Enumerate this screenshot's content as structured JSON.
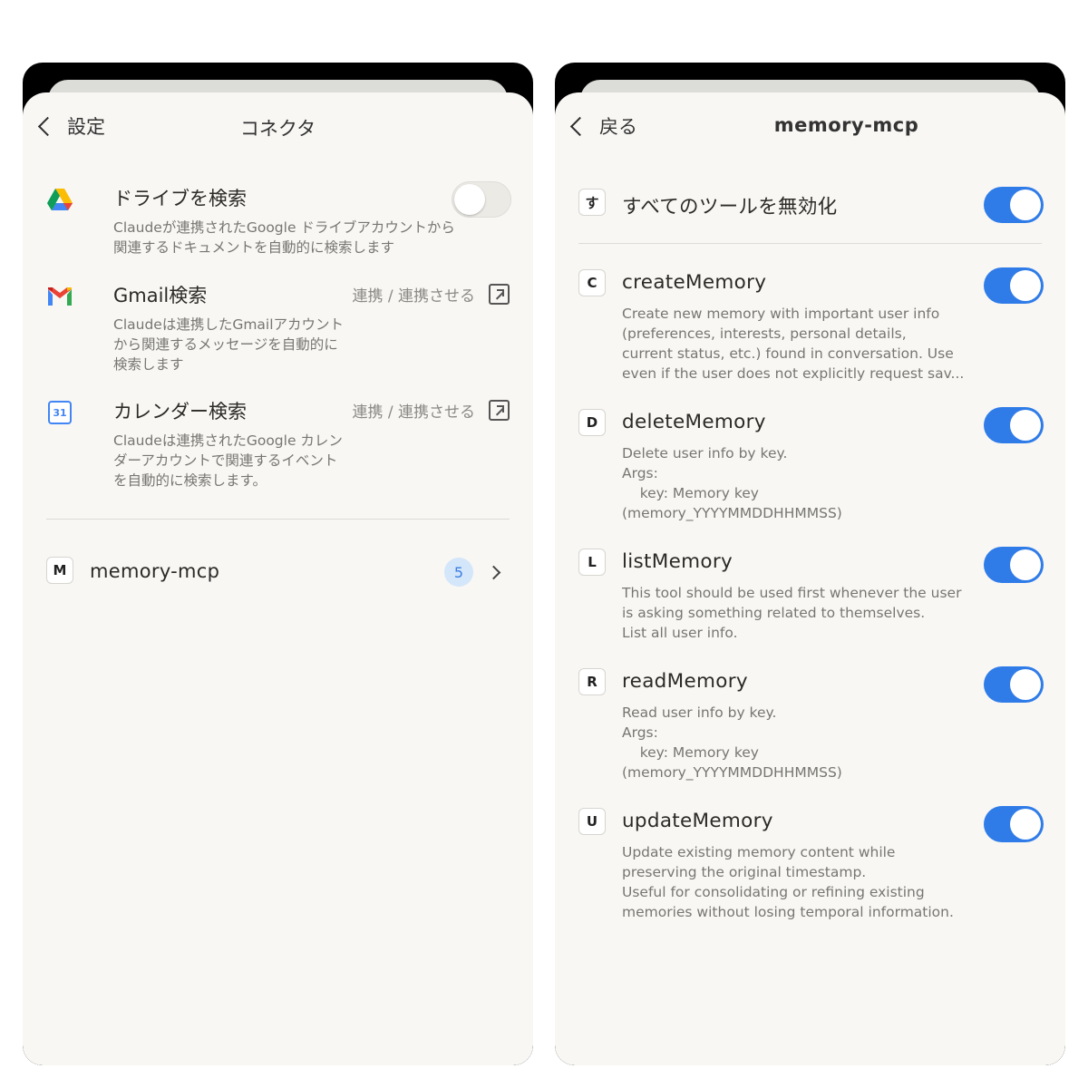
{
  "left": {
    "back_label": "設定",
    "title": "コネクタ",
    "connectors": [
      {
        "title": "ドライブを検索",
        "description": "Claudeが連携されたGoogle ドライブアカウントから関連するドキュメントを自動的に検索します",
        "icon": "google-drive-icon",
        "enabled": false
      },
      {
        "title": "Gmail検索",
        "description": "Claudeは連携したGmailアカウントから関連するメッセージを自動的に検索します",
        "icon": "gmail-icon",
        "action": "連携 / 連携させる"
      },
      {
        "title": "カレンダー検索",
        "description": "Claudeは連携されたGoogle カレンダーアカウントで関連するイベントを自動的に検索します。",
        "icon": "google-calendar-icon",
        "icon_text": "31",
        "action": "連携 / 連携させる"
      }
    ],
    "custom": {
      "letter": "M",
      "name": "memory-mcp",
      "count": "5"
    }
  },
  "right": {
    "back_label": "戻る",
    "title": "memory-mcp",
    "disable_all": {
      "letter": "す",
      "label": "すべてのツールを無効化",
      "enabled": true
    },
    "tools": [
      {
        "letter": "C",
        "name": "createMemory",
        "description": "Create new memory with important user info\n(preferences, interests, personal details,\ncurrent status, etc.) found in conversation. Use\neven if the user does not explicitly request sav...",
        "enabled": true
      },
      {
        "letter": "D",
        "name": "deleteMemory",
        "description": "Delete user info by key.\nArgs:\n    key: Memory key\n(memory_YYYYMMDDHHMMSS)",
        "enabled": true
      },
      {
        "letter": "L",
        "name": "listMemory",
        "description": "This tool should be used first whenever the user\nis asking something related to themselves.\nList all user info.",
        "enabled": true
      },
      {
        "letter": "R",
        "name": "readMemory",
        "description": "Read user info by key.\nArgs:\n    key: Memory key\n(memory_YYYYMMDDHHMMSS)",
        "enabled": true
      },
      {
        "letter": "U",
        "name": "updateMemory",
        "description": "Update existing memory content while\npreserving the original timestamp.\nUseful for consolidating or refining existing\nmemories without losing temporal information.",
        "enabled": true
      }
    ]
  },
  "colors": {
    "toggle_on": "#2f7ce8",
    "sheet_bg": "#f8f7f4",
    "badge_bg": "#d4e6fa"
  }
}
